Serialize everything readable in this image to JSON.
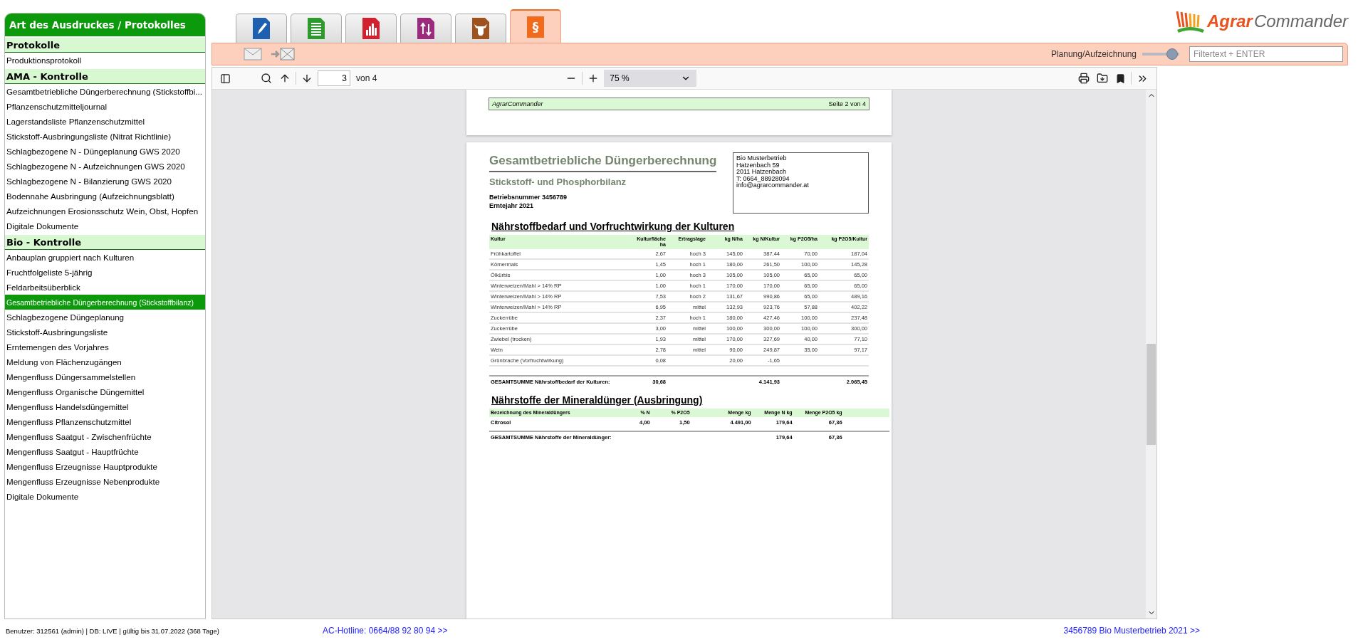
{
  "sidebar": {
    "title": "Art des Ausdruckes / Protokolles",
    "sections": [
      {
        "title": "Protokolle",
        "items": [
          {
            "label": "Produktionsprotokoll",
            "selected": false
          }
        ]
      },
      {
        "title": "AMA - Kontrolle",
        "items": [
          {
            "label": "Gesamtbetriebliche Düngerberechnung (Stickstoffbi...",
            "selected": false
          },
          {
            "label": "Pflanzenschutzmitteljournal",
            "selected": false
          },
          {
            "label": "Lagerstandsliste Pflanzenschutzmittel",
            "selected": false
          },
          {
            "label": "Stickstoff-Ausbringungsliste (Nitrat Richtlinie)",
            "selected": false
          },
          {
            "label": "Schlagbezogene N - Düngeplanung GWS 2020",
            "selected": false
          },
          {
            "label": "Schlagbezogene N - Aufzeichnungen GWS 2020",
            "selected": false
          },
          {
            "label": "Schlagbezogene N - Bilanzierung GWS 2020",
            "selected": false
          },
          {
            "label": "Bodennahe Ausbringung (Aufzeichnungsblatt)",
            "selected": false
          },
          {
            "label": "Aufzeichnungen Erosionsschutz Wein, Obst, Hopfen",
            "selected": false
          },
          {
            "label": "Digitale Dokumente",
            "selected": false
          }
        ]
      },
      {
        "title": "Bio - Kontrolle",
        "items": [
          {
            "label": "Anbauplan gruppiert nach Kulturen",
            "selected": false
          },
          {
            "label": "Fruchtfolgeliste 5-jährig",
            "selected": false
          },
          {
            "label": "Feldarbeitsüberblick",
            "selected": false
          },
          {
            "label": "Gesamtbetriebliche Düngerberechnung (Stickstoffbilanz)",
            "selected": true
          },
          {
            "label": "Schlagbezogene Düngeplanung",
            "selected": false
          },
          {
            "label": "Stickstoff-Ausbringungsliste",
            "selected": false
          },
          {
            "label": "Erntemengen des Vorjahres",
            "selected": false
          },
          {
            "label": "Meldung von Flächenzugängen",
            "selected": false
          },
          {
            "label": "Mengenfluss Düngersammelstellen",
            "selected": false
          },
          {
            "label": "Mengenfluss Organische Düngemittel",
            "selected": false
          },
          {
            "label": "Mengenfluss Handelsdüngemittel",
            "selected": false
          },
          {
            "label": "Mengenfluss Pflanzenschutzmittel",
            "selected": false
          },
          {
            "label": "Mengenfluss Saatgut - Zwischenfrüchte",
            "selected": false
          },
          {
            "label": "Mengenfluss Saatgut - Hauptfrüchte",
            "selected": false
          },
          {
            "label": "Mengenfluss Erzeugnisse Hauptprodukte",
            "selected": false
          },
          {
            "label": "Mengenfluss Erzeugnisse Nebenprodukte",
            "selected": false
          },
          {
            "label": "Digitale Dokumente",
            "selected": false
          }
        ]
      }
    ]
  },
  "tabs": [
    {
      "kind": "pen",
      "color": "#1f5fb0",
      "selected": false
    },
    {
      "kind": "list",
      "color": "#2e9a2e",
      "selected": false
    },
    {
      "kind": "chart",
      "color": "#d3202e",
      "selected": false
    },
    {
      "kind": "arrows",
      "color": "#9c2a7d",
      "selected": false
    },
    {
      "kind": "cow",
      "color": "#a0521e",
      "selected": false
    },
    {
      "kind": "symbol",
      "symbol": "§",
      "color": "#f26b1d",
      "selected": true
    }
  ],
  "logo": {
    "first": "Agrar",
    "second": "Commander"
  },
  "toolbar": {
    "mode_label": "Planung/Aufzeichnung",
    "mode_slider": {
      "level": 1
    },
    "filter": {
      "placeholder": "Filtertext + ENTER"
    }
  },
  "viewer": {
    "page_input": "3",
    "page_count": "von 4",
    "zoom": "75 %",
    "prev_page_footer": {
      "left": "AgrarCommander",
      "right": "Seite 2 von 4"
    },
    "document": {
      "title": "Gesamtbetriebliche Düngerberechnung",
      "subtitle": "Stickstoff- und Phosphorbilanz",
      "info": [
        "Betriebsnummer 3456789",
        "Erntejahr 2021"
      ],
      "address": [
        "Bio Musterbetrieb",
        "Hatzenbach 59",
        "2011 Hatzenbach",
        "T: 0664_88928094",
        "info@agrarcommander.at"
      ],
      "tables": [
        {
          "kind": "crops",
          "heading": "Nährstoffbedarf und Vorfruchtwirkung der Kulturen",
          "columns": [
            "Kultur",
            "Kulturfläche ha",
            "Ertragslage",
            "kg N/ha",
            "kg N/Kultur",
            "kg P2O5/ha",
            "kg P2O5/Kultur"
          ],
          "rows": [
            [
              "Frühkartoffel",
              "2,67",
              "hoch 3",
              "145,00",
              "387,44",
              "70,00",
              "187,04"
            ],
            [
              "Körnermais",
              "1,45",
              "hoch 1",
              "180,00",
              "261,50",
              "100,00",
              "145,28"
            ],
            [
              "Ölkürbis",
              "1,00",
              "hoch 3",
              "105,00",
              "105,00",
              "65,00",
              "65,00"
            ],
            [
              "Winterweizen/Mahl > 14% RP",
              "1,00",
              "hoch 1",
              "170,00",
              "170,00",
              "65,00",
              "65,00"
            ],
            [
              "Winterweizen/Mahl > 14% RP",
              "7,53",
              "hoch 2",
              "131,67",
              "990,86",
              "65,00",
              "489,16"
            ],
            [
              "Winterweizen/Mahl > 14% RP",
              "6,95",
              "mittel",
              "132,93",
              "923,76",
              "57,88",
              "402,22"
            ],
            [
              "Zuckerrübe",
              "2,37",
              "hoch 1",
              "180,00",
              "427,46",
              "100,00",
              "237,48"
            ],
            [
              "Zuckerrübe",
              "3,00",
              "mittel",
              "100,00",
              "300,00",
              "100,00",
              "300,00"
            ],
            [
              "Zwiebel (trocken)",
              "1,93",
              "mittel",
              "170,00",
              "327,69",
              "40,00",
              "77,10"
            ],
            [
              "Wein",
              "2,78",
              "mittel",
              "90,00",
              "249,87",
              "35,00",
              "97,17"
            ],
            [
              "Grünbrache (Vorfruchtwirkung)",
              "0,08",
              null,
              "20,00",
              "-1,65",
              null,
              null
            ]
          ],
          "total": {
            "label": "GESAMTSUMME Nährstoffbedarf der Kulturen:",
            "column_2": "30,68",
            "column_5": "4.141,93",
            "column_7": "2.065,45"
          }
        },
        {
          "kind": "fertilizer",
          "heading": "Nährstoffe der Mineraldünger (Ausbringung)",
          "columns": [
            "Bezeichnung des Mineraldüngers",
            "% N",
            "% P2O5",
            "Menge kg",
            "Menge N kg",
            "Menge P2O5 kg"
          ],
          "rows": [
            [
              "Citrosol",
              "4,00",
              "1,50",
              "4.491,00",
              "179,64",
              "67,36"
            ]
          ],
          "total": {
            "label": "GESAMTSUMME Nährstoffe der Mineraldünger:",
            "column_5": "179,64",
            "column_6": "67,36"
          }
        }
      ]
    }
  },
  "footer": {
    "user": "Benutzer: 312561 (admin) | DB: LIVE | gültig bis 31.07.2022 (368 Tage)",
    "hotline": "AC-Hotline: 0664/88 92 80 94 >>",
    "company": "3456789 Bio Musterbetrieb 2021 >>"
  }
}
